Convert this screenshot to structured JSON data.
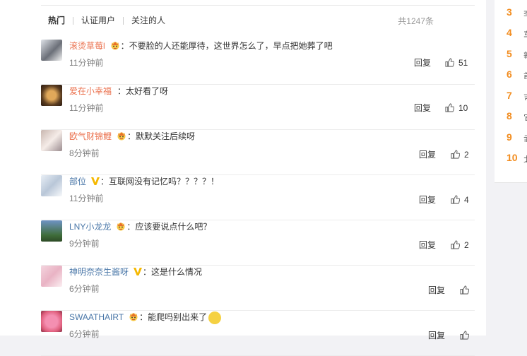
{
  "tabs": [
    "热门",
    "认证用户",
    "关注的人"
  ],
  "total": "共1247条",
  "reply_label": "回复",
  "comments": [
    {
      "name": "滚烫草莓l",
      "badge": "crown",
      "text": "：不要脸的人还能厚待，这世界怎么了，早点把她葬了吧",
      "time": "11分钟前",
      "likes": "51"
    },
    {
      "name": "爱在小幸福",
      "badge": "",
      "text": "：太好看了呀",
      "time": "11分钟前",
      "likes": "10"
    },
    {
      "name": "欧气财锦鲤",
      "badge": "crown",
      "text": "：默默关注后续呀",
      "time": "8分钟前",
      "likes": "2"
    },
    {
      "name": "部位",
      "badge": "v",
      "text": "：互联网没有记忆吗？？？？！",
      "time": "11分钟前",
      "likes": "4"
    },
    {
      "name": "LNY小龙龙",
      "badge": "crown",
      "text": "：应该要说点什么吧？",
      "time": "9分钟前",
      "likes": "2"
    },
    {
      "name": "神明奈奈生酱呀",
      "badge": "v",
      "text": "：这是什么情况",
      "time": "6分钟前",
      "likes": ""
    },
    {
      "name": "SWAATHAIRT",
      "badge": "crown",
      "text": "：能爬吗别出来了",
      "time": "6分钟前",
      "likes": ""
    }
  ],
  "ranks": [
    {
      "num": "3",
      "char": "李"
    },
    {
      "num": "4",
      "char": "车"
    },
    {
      "num": "5",
      "char": "辣"
    },
    {
      "num": "6",
      "char": "前"
    },
    {
      "num": "7",
      "char": "吉"
    },
    {
      "num": "8",
      "char": "宣"
    },
    {
      "num": "9",
      "char": "武"
    },
    {
      "num": "10",
      "char": "北"
    }
  ],
  "colors": {
    "name": "#eb7350",
    "rank": "#f28c1e",
    "verified": "#f5b800"
  }
}
